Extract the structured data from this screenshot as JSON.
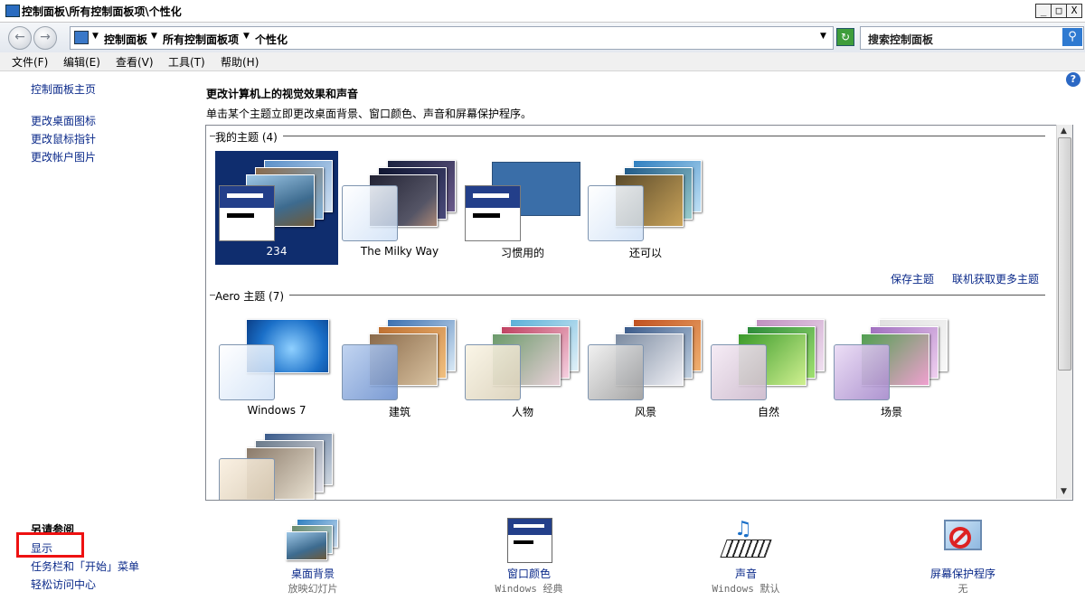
{
  "window": {
    "title": "控制面板\\所有控制面板项\\个性化",
    "minimize": "_",
    "maximize": "□",
    "close": "X"
  },
  "address": {
    "crumbs": [
      "控制面板",
      "所有控制面板项",
      "个性化"
    ],
    "search_placeholder": "搜索控制面板"
  },
  "menu": [
    "文件(F)",
    "编辑(E)",
    "查看(V)",
    "工具(T)",
    "帮助(H)"
  ],
  "sidebar": {
    "home": "控制面板主页",
    "links": [
      "更改桌面图标",
      "更改鼠标指针",
      "更改帐户图片"
    ],
    "see_also_title": "另请参阅",
    "see_also": [
      "显示",
      "任务栏和「开始」菜单",
      "轻松访问中心"
    ]
  },
  "main": {
    "heading": "更改计算机上的视觉效果和声音",
    "subheading": "单击某个主题立即更改桌面背景、窗口颜色、声音和屏幕保护程序。",
    "my_themes_title": "我的主题 (4)",
    "my_themes": [
      "234",
      "The Milky Way",
      "习惯用的",
      "还可以"
    ],
    "save_theme": "保存主题",
    "get_more": "联机获取更多主题",
    "aero_title": "Aero 主题 (7)",
    "aero_themes": [
      "Windows 7",
      "建筑",
      "人物",
      "风景",
      "自然",
      "场景"
    ]
  },
  "bottom": [
    {
      "title": "桌面背景",
      "sub": "放映幻灯片"
    },
    {
      "title": "窗口颜色",
      "sub": "Windows 经典"
    },
    {
      "title": "声音",
      "sub": "Windows 默认"
    },
    {
      "title": "屏幕保护程序",
      "sub": "无"
    }
  ],
  "colors": {
    "link": "#0b2a8a",
    "selected_theme_bg": "#0f2d6e",
    "highlight_box": "#e11111"
  }
}
